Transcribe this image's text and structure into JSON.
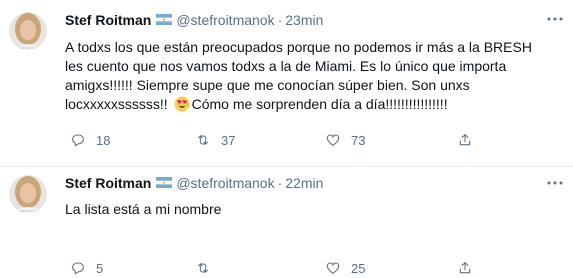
{
  "tweets": [
    {
      "name": "Stef Roitman",
      "handle": "@stefroitmanok",
      "time": "23min",
      "lines": [
        "A todxs los que están preocupados porque no podemos ir más a la BRESH",
        "les cuento que nos vamos todxs a la de Miami. Es lo único que importa",
        "amigxs!!!!!! Siempre supe que me conocían súper bien. Son unxs",
        "locxxxxxssssss!!",
        "Cómo me sorprenden día a día!!!!!!!!!!!!!!!!"
      ],
      "reply_count": "18",
      "retweet_count": "37",
      "like_count": "73"
    },
    {
      "name": "Stef Roitman",
      "handle": "@stefroitmanok",
      "time": "22min",
      "lines": [
        "La lista está a mi nombre"
      ],
      "reply_count": "5",
      "retweet_count": "",
      "like_count": "25"
    }
  ],
  "icons": {
    "flag": "argentina-flag-icon",
    "emoji": "heart-eyes-emoji-icon",
    "more": "more-icon",
    "reply": "reply-icon",
    "retweet": "retweet-icon",
    "like": "like-icon",
    "share": "share-icon"
  },
  "colors": {
    "secondary_text": "#5b7083",
    "primary_text": "#0f1419",
    "divider": "#e6ecf0"
  }
}
